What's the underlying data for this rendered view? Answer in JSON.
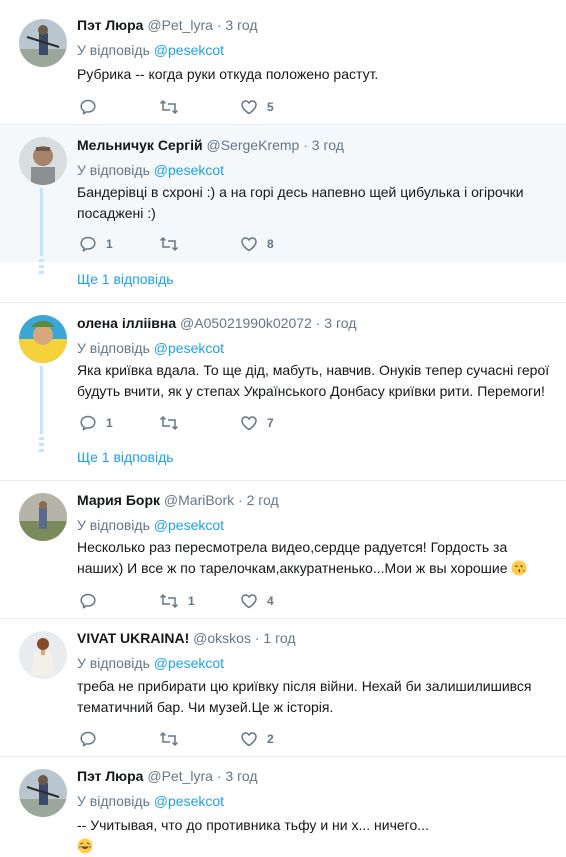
{
  "tweets": [
    {
      "name": "Пэт Люра",
      "handle": "@Pet_lyra",
      "sep": "·",
      "time": "3 год",
      "reply_prefix": "У відповідь",
      "reply_to": "@pesekcot",
      "text": "Рубрика -- когда руки откуда положено растут.",
      "reply_count": "",
      "retweet_count": "",
      "like_count": "5"
    },
    {
      "name": "Мельничук Сергій",
      "handle": "@SergeKremp",
      "sep": "·",
      "time": "3 год",
      "reply_prefix": "У відповідь",
      "reply_to": "@pesekcot",
      "text": "Бандерівці в схроні :) а на горі десь напевно щей цибулька і огірочки посаджені :)",
      "reply_count": "1",
      "retweet_count": "",
      "like_count": "8",
      "more_replies": "Ще 1 відповідь"
    },
    {
      "name": "олена ілліівна",
      "handle": "@A05021990k02072",
      "sep": "·",
      "time": "3 год",
      "reply_prefix": "У відповідь",
      "reply_to": "@pesekcot",
      "text": "Яка криївка вдала. То ще дід, мабуть, навчив. Онуків тепер сучасні герої будуть вчити, як у степах Українського Донбасу криївки рити. Перемоги!",
      "reply_count": "1",
      "retweet_count": "",
      "like_count": "7",
      "more_replies": "Ще 1 відповідь"
    },
    {
      "name": "Мария Борк",
      "handle": "@MariBork",
      "sep": "·",
      "time": "2 год",
      "reply_prefix": "У відповідь",
      "reply_to": "@pesekcot",
      "text": "Несколько раз пересмотрела видео,сердце радуется! Гордость за наших) И все ж по тарелочкам,аккуратненько...Мои ж вы хорошие",
      "reply_count": "",
      "retweet_count": "1",
      "like_count": "4"
    },
    {
      "name": "VIVAT UKRAINA!",
      "handle": "@okskos",
      "sep": "·",
      "time": "1 год",
      "reply_prefix": "У відповідь",
      "reply_to": "@pesekcot",
      "text": "треба не прибирати цю криївку після війни. Нехай би залишилишився тематичний бар. Чи музей.Це ж історія.",
      "reply_count": "",
      "retweet_count": "",
      "like_count": "2"
    },
    {
      "name": "Пэт Люра",
      "handle": "@Pet_lyra",
      "sep": "·",
      "time": "3 год",
      "reply_prefix": "У відповідь",
      "reply_to": "@pesekcot",
      "text": "-- Учитывая, что до противника тьфу и ни х... ничего..."
    }
  ],
  "colors": {
    "accent": "#1da1f2",
    "muted": "#657786",
    "thread": "#c4e4fb",
    "highlight_bg": "#f5f8fa"
  }
}
